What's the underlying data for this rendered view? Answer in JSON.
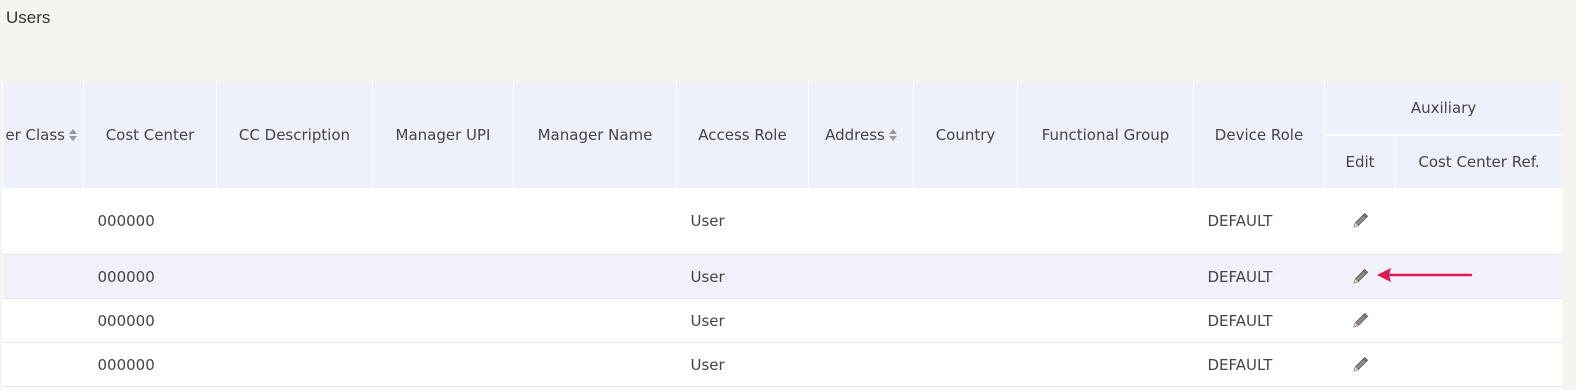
{
  "page": {
    "title": "Users"
  },
  "table": {
    "headers": {
      "user_class": "er Class",
      "cost_center": "Cost Center",
      "cc_description": "CC Description",
      "manager_upi": "Manager UPI",
      "manager_name": "Manager Name",
      "access_role": "Access Role",
      "address": "Address",
      "country": "Country",
      "functional_group": "Functional Group",
      "device_role": "Device Role",
      "auxiliary": "Auxiliary",
      "edit": "Edit",
      "cost_center_ref": "Cost Center Ref."
    },
    "rows": [
      {
        "user_class": "",
        "cost_center": "000000",
        "cc_description": "",
        "manager_upi": "",
        "manager_name": "",
        "access_role": "User",
        "address": "",
        "country": "",
        "functional_group": "",
        "device_role": "DEFAULT",
        "cost_center_ref": ""
      },
      {
        "user_class": "",
        "cost_center": "000000",
        "cc_description": "",
        "manager_upi": "",
        "manager_name": "",
        "access_role": "User",
        "address": "",
        "country": "",
        "functional_group": "",
        "device_role": "DEFAULT",
        "cost_center_ref": ""
      },
      {
        "user_class": "",
        "cost_center": "000000",
        "cc_description": "",
        "manager_upi": "",
        "manager_name": "",
        "access_role": "User",
        "address": "",
        "country": "",
        "functional_group": "",
        "device_role": "DEFAULT",
        "cost_center_ref": ""
      },
      {
        "user_class": "",
        "cost_center": "000000",
        "cc_description": "",
        "manager_upi": "",
        "manager_name": "",
        "access_role": "User",
        "address": "",
        "country": "",
        "functional_group": "",
        "device_role": "DEFAULT",
        "cost_center_ref": ""
      }
    ]
  },
  "icons": {
    "edit": "pencil-icon",
    "sort": "sort-icon",
    "annotation": "arrow-annotation"
  },
  "colors": {
    "header_bg": "#eef0fc",
    "highlight_row_bg": "#f0f1fb",
    "annotation_arrow": "#e0194f",
    "page_bg": "#f5f5f0"
  }
}
